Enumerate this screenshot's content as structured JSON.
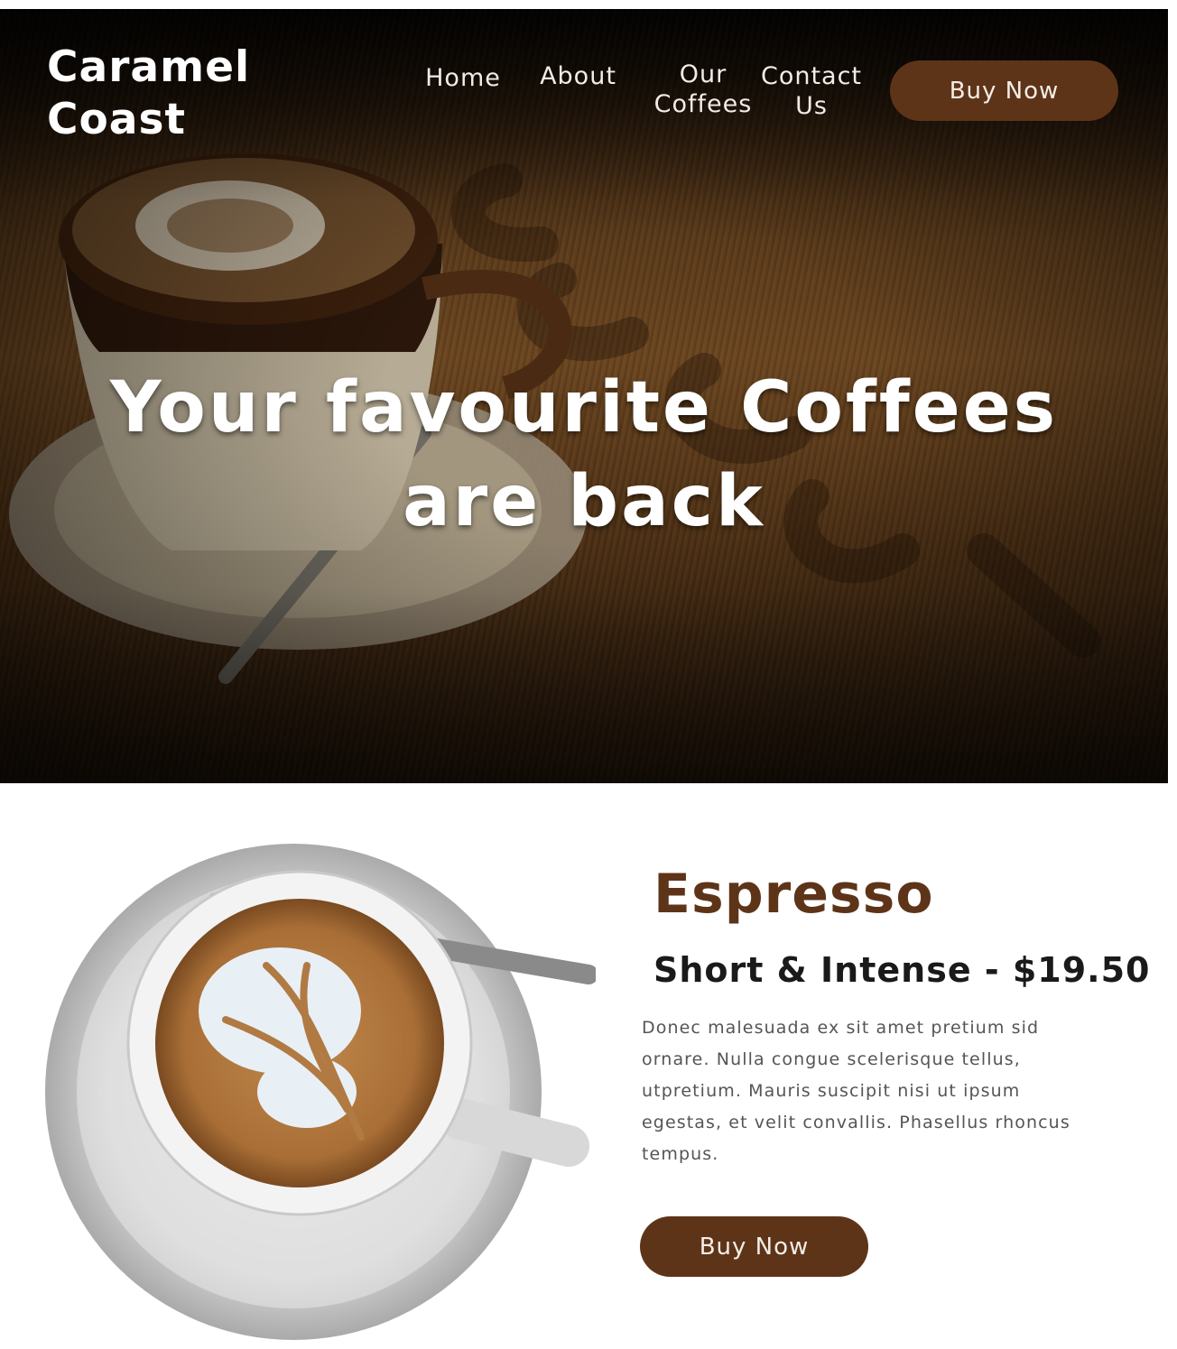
{
  "brand": {
    "name": "Caramel Coast"
  },
  "nav": {
    "items": [
      {
        "label": "Home"
      },
      {
        "label": "About"
      },
      {
        "label": "Our Coffees"
      },
      {
        "label": "Contact Us"
      }
    ],
    "cta_label": "Buy Now"
  },
  "hero": {
    "headline": "Your favourite Coffees are back",
    "image_icon": "latte-cup-on-table-photo"
  },
  "product": {
    "name": "Espresso",
    "subtitle": "Short & Intense - $19.50",
    "description": "Donec malesuada ex sit amet pretium sid ornare. Nulla congue scelerisque tellus, utpretium. Mauris suscipit nisi ut ipsum egestas, et velit convallis. Phasellus rhoncus tempus.",
    "cta_label": "Buy Now",
    "image_icon": "latte-art-cup-topdown-photo"
  },
  "colors": {
    "accent": "#5e3419",
    "heading_brown": "#5e3419",
    "body_text": "#555555"
  }
}
